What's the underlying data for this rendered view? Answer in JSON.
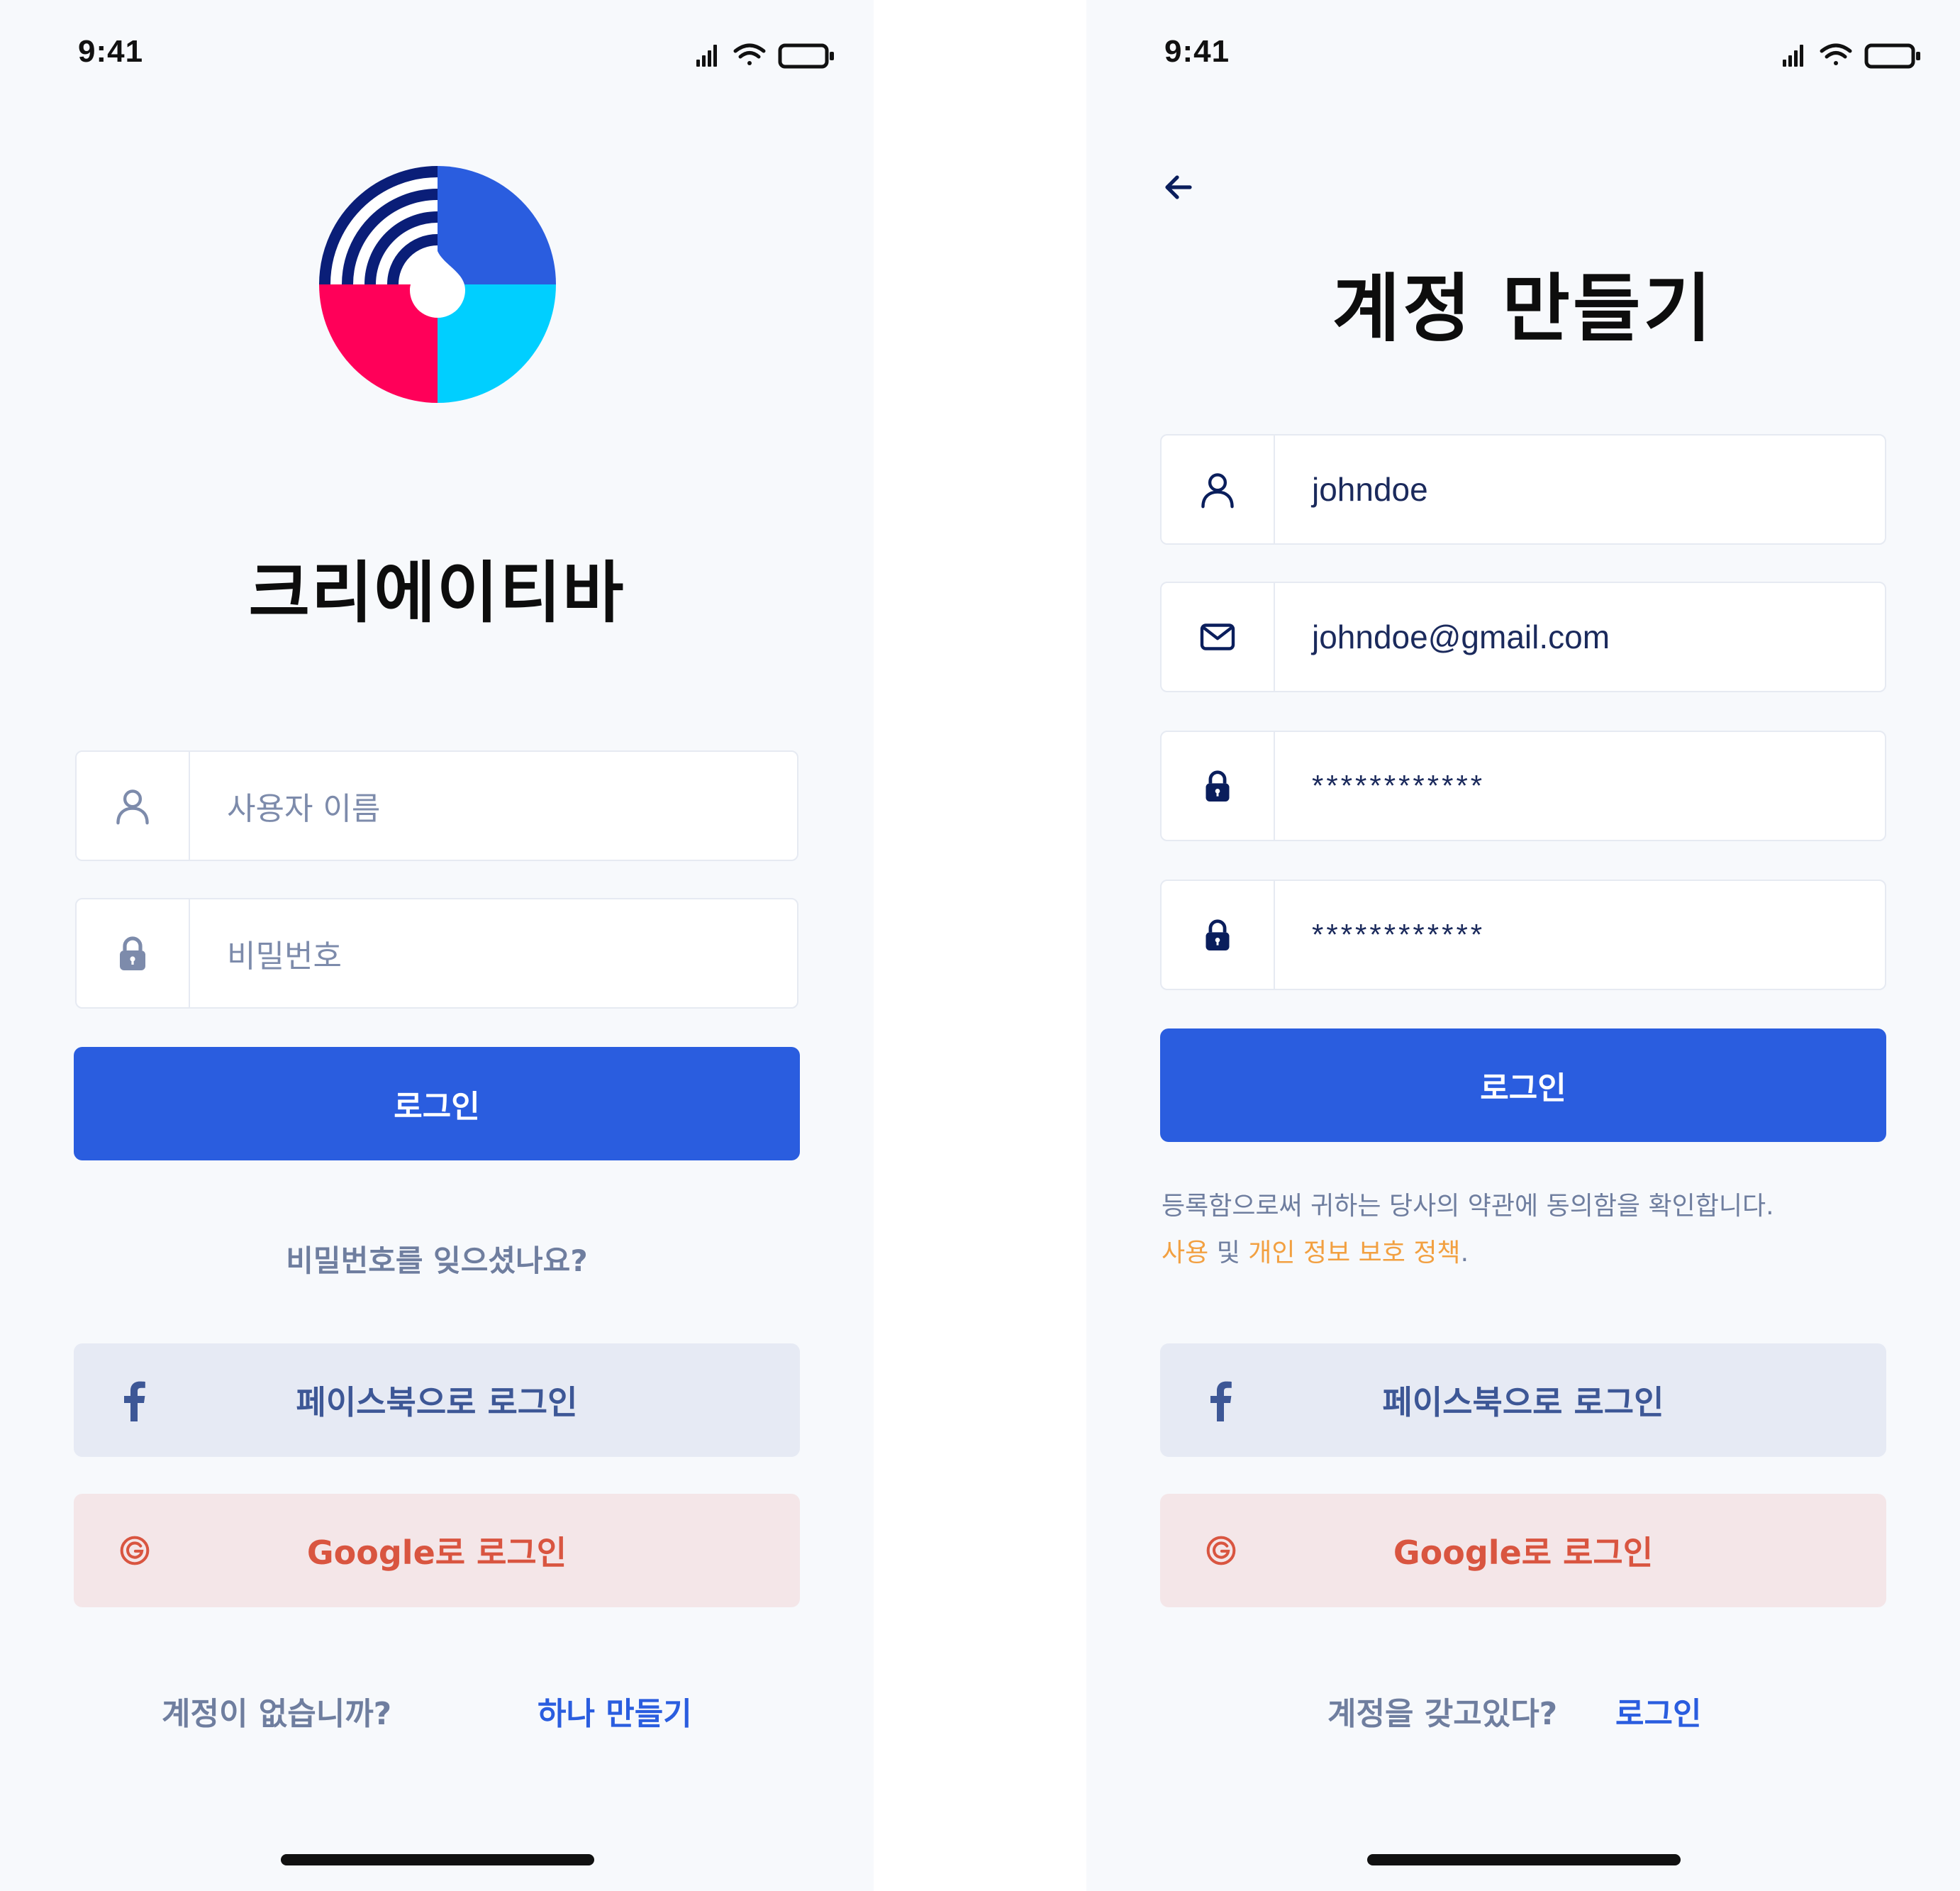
{
  "status_bar": {
    "time": "9:41"
  },
  "login_screen": {
    "app_name": "크리에이티바",
    "username_placeholder": "사용자 이름",
    "password_placeholder": "비밀번호",
    "login_button": "로그인",
    "forgot_password": "비밀번호를 잊으셨나요?",
    "facebook_button": "페이스북으로 로그인",
    "google_button": "Google로 로그인",
    "no_account_text": "계정이 없습니까?",
    "create_account_link": "하나 만들기"
  },
  "signup_screen": {
    "title": "계정 만들기",
    "username_value": "johndoe",
    "email_value": "johndoe@gmail.com",
    "password_value": "************",
    "confirm_password_value": "************",
    "login_button": "로그인",
    "terms_line1": "등록함으로써 귀하는 당사의 약관에 동의함을 확인합니다.",
    "terms_usage": "사용",
    "terms_and": " 및 ",
    "terms_privacy": "개인 정보 보호 정책",
    "terms_period": ".",
    "facebook_button": "페이스북으로 로그인",
    "google_button": "Google로 로그인",
    "have_account_text": "계정을 갖고있다?",
    "login_link": "로그인"
  },
  "icons": {
    "signal": "signal-icon",
    "wifi": "wifi-icon",
    "battery": "battery-icon",
    "user": "user-icon",
    "lock": "lock-icon",
    "mail": "mail-icon",
    "back": "arrow-left-icon",
    "facebook": "facebook-icon",
    "google": "google-icon"
  },
  "colors": {
    "primary": "#2a5ddf",
    "facebook_bg": "#e6eaf4",
    "facebook_text": "#3d5796",
    "google_bg": "#f4e6e8",
    "google_text": "#d95540",
    "terms_link": "#f2a041",
    "logo_blue": "#2a5ddf",
    "logo_cyan": "#00cfff",
    "logo_pink": "#ff0059",
    "logo_navy": "#0a1e78"
  }
}
